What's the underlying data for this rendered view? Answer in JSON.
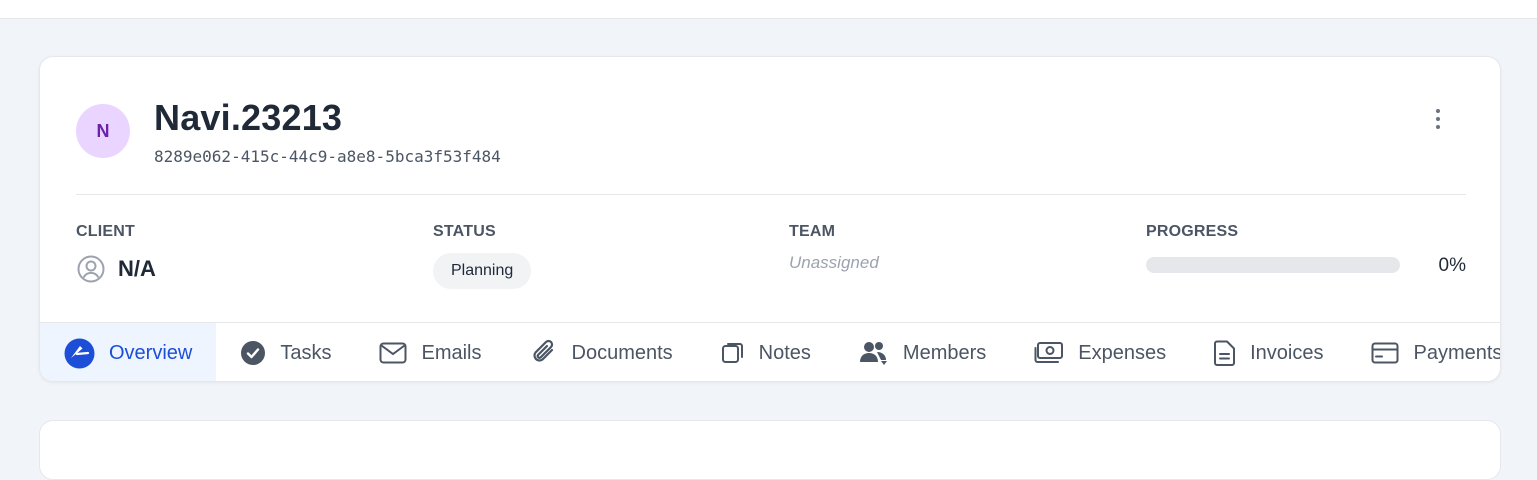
{
  "project": {
    "avatar_initial": "N",
    "title": "Navi.23213",
    "id": "8289e062-415c-44c9-a8e8-5bca3f53f484"
  },
  "meta": {
    "client_label": "CLIENT",
    "client_value": "N/A",
    "status_label": "STATUS",
    "status_value": "Planning",
    "team_label": "TEAM",
    "team_value": "Unassigned",
    "progress_label": "PROGRESS",
    "progress_value": 0,
    "progress_text": "0%"
  },
  "tabs": [
    {
      "label": "Overview",
      "icon": "overview-icon",
      "active": true
    },
    {
      "label": "Tasks",
      "icon": "check-circle-icon",
      "active": false
    },
    {
      "label": "Emails",
      "icon": "mail-icon",
      "active": false
    },
    {
      "label": "Documents",
      "icon": "paperclip-icon",
      "active": false
    },
    {
      "label": "Notes",
      "icon": "note-icon",
      "active": false
    },
    {
      "label": "Members",
      "icon": "users-icon",
      "active": false
    },
    {
      "label": "Expenses",
      "icon": "money-icon",
      "active": false
    },
    {
      "label": "Invoices",
      "icon": "document-icon",
      "active": false
    },
    {
      "label": "Payments",
      "icon": "credit-card-icon",
      "active": false
    }
  ],
  "colors": {
    "accent": "#1d4ed8",
    "avatar_bg": "#e9d5ff",
    "avatar_text": "#6b21a8",
    "page_bg": "#f1f4f8"
  }
}
